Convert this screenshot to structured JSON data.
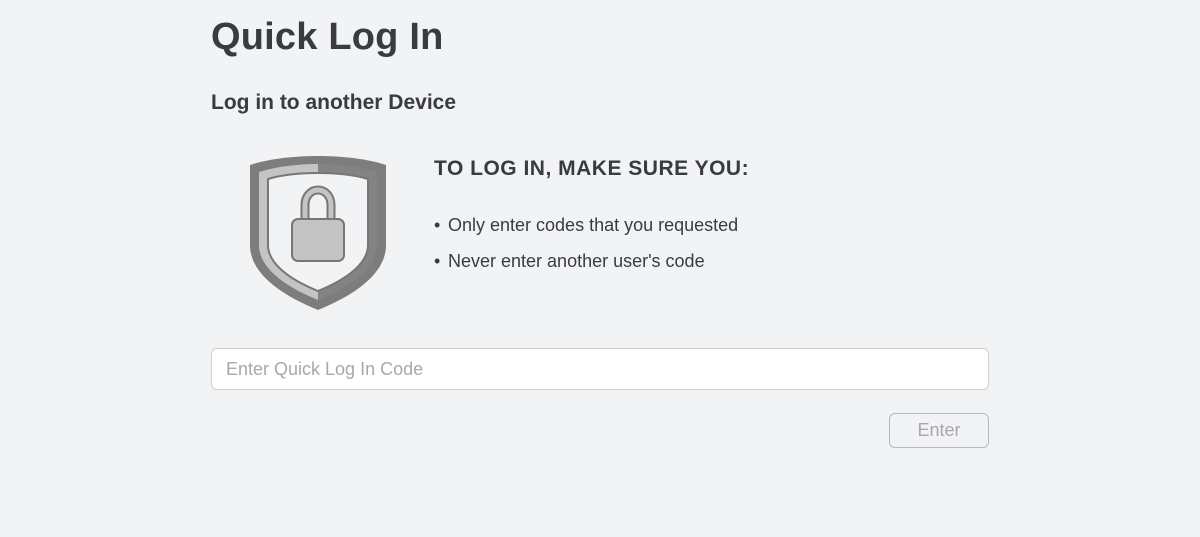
{
  "page": {
    "title": "Quick Log In",
    "subtitle": "Log in to another Device"
  },
  "instructions": {
    "icon": "shield-lock-icon",
    "heading": "TO LOG IN, MAKE SURE YOU:",
    "bullet": "•",
    "rules": [
      "Only enter codes that you requested",
      "Never enter another user's code"
    ]
  },
  "code_entry": {
    "value": "",
    "placeholder": "Enter Quick Log In Code",
    "submit_label": "Enter"
  },
  "colors": {
    "background": "#f2f3f5",
    "text": "#393b3d",
    "placeholder": "#a6a8ab",
    "input_border": "#cfd1d4",
    "shield_dark": "#808080",
    "shield_light": "#c3c3c3"
  }
}
